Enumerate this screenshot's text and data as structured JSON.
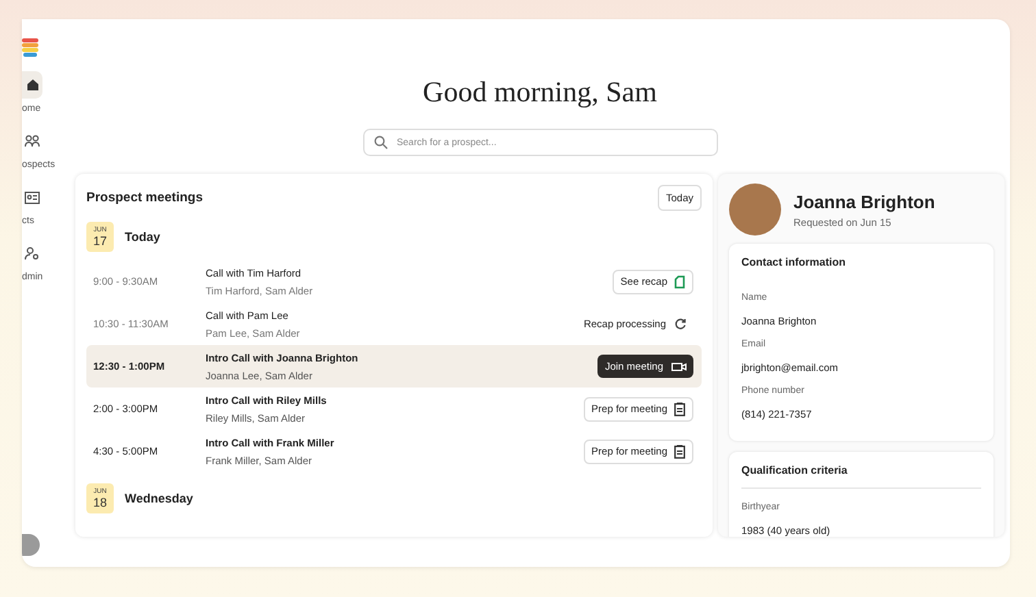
{
  "sidebar": {
    "items": [
      {
        "label": "ome",
        "kind": "home",
        "selected": true
      },
      {
        "label": "ospects",
        "kind": "people",
        "selected": false
      },
      {
        "label": "cts",
        "kind": "card",
        "selected": false
      },
      {
        "label": "dmin",
        "kind": "admin",
        "selected": false
      }
    ]
  },
  "greeting": "Good morning, Sam",
  "search": {
    "placeholder": "Search for a prospect..."
  },
  "meetings": {
    "title": "Prospect meetings",
    "today_button": "Today",
    "days": [
      {
        "month": "JUN",
        "day": "17",
        "label": "Today",
        "meetings": [
          {
            "time": "9:00 - 9:30AM",
            "title": "Call with Tim Harford",
            "attendees": "Tim Harford, Sam Alder",
            "past": true,
            "selected": false,
            "action": {
              "kind": "recap",
              "label": "See recap"
            }
          },
          {
            "time": "10:30 - 11:30AM",
            "title": "Call with Pam Lee",
            "attendees": "Pam Lee, Sam Alder",
            "past": true,
            "selected": false,
            "action": {
              "kind": "processing",
              "label": "Recap processing"
            }
          },
          {
            "time": "12:30 - 1:00PM",
            "title": "Intro Call with Joanna Brighton",
            "attendees": "Joanna Lee, Sam Alder",
            "past": false,
            "selected": true,
            "action": {
              "kind": "join",
              "label": "Join meeting"
            }
          },
          {
            "time": "2:00 - 3:00PM",
            "title": "Intro Call with Riley Mills",
            "attendees": "Riley Mills, Sam Alder",
            "past": false,
            "selected": false,
            "action": {
              "kind": "prep",
              "label": "Prep for meeting"
            }
          },
          {
            "time": "4:30 - 5:00PM",
            "title": "Intro Call with Frank Miller",
            "attendees": "Frank Miller, Sam Alder",
            "past": false,
            "selected": false,
            "action": {
              "kind": "prep",
              "label": "Prep for meeting"
            }
          }
        ]
      },
      {
        "month": "JUN",
        "day": "18",
        "label": "Wednesday"
      }
    ]
  },
  "prospect": {
    "name": "Joanna Brighton",
    "requested": "Requested on Jun 15",
    "sections": [
      {
        "title": "Contact information",
        "divider": false,
        "fields": [
          {
            "label": "Name",
            "value": "Joanna Brighton"
          },
          {
            "label": "Email",
            "value": "jbrighton@email.com"
          },
          {
            "label": "Phone number",
            "value": "(814) 221-7357"
          }
        ]
      },
      {
        "title": "Qualification criteria",
        "divider": true,
        "fields": [
          {
            "label": "Birthyear",
            "value": "1983 (40 years old)"
          }
        ]
      }
    ]
  }
}
